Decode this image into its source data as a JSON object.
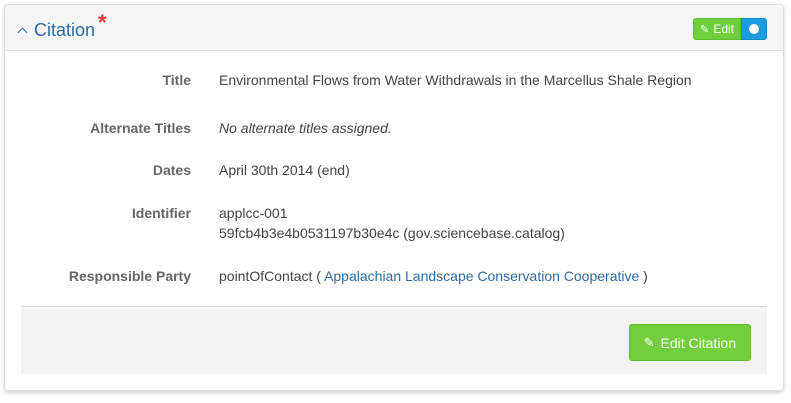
{
  "header": {
    "title": "Citation",
    "required_marker": "*",
    "edit_label": "Edit"
  },
  "fields": {
    "title": {
      "label": "Title",
      "value": "Environmental Flows from Water Withdrawals in the Marcellus Shale Region"
    },
    "alternate_titles": {
      "label": "Alternate Titles",
      "value": "No alternate titles assigned."
    },
    "dates": {
      "label": "Dates",
      "value": "April 30th 2014 (end)"
    },
    "identifier": {
      "label": "Identifier",
      "values": [
        "applcc-001",
        "59fcb4b3e4b0531197b30e4c (gov.sciencebase.catalog)"
      ]
    },
    "responsible_party": {
      "label": "Responsible Party",
      "role": "pointOfContact (",
      "party": "Appalachian Landscape Conservation Cooperative",
      "suffix": ")"
    }
  },
  "footer": {
    "edit_citation_label": "Edit Citation"
  },
  "icons": {
    "pencil": "pencil-icon",
    "chevron": "chevron-up-icon"
  },
  "colors": {
    "heading_text": "#2f6aa3",
    "required": "#e83a2e",
    "edit_green": "#72cf3b",
    "toggle_blue": "#1a9ce0"
  }
}
